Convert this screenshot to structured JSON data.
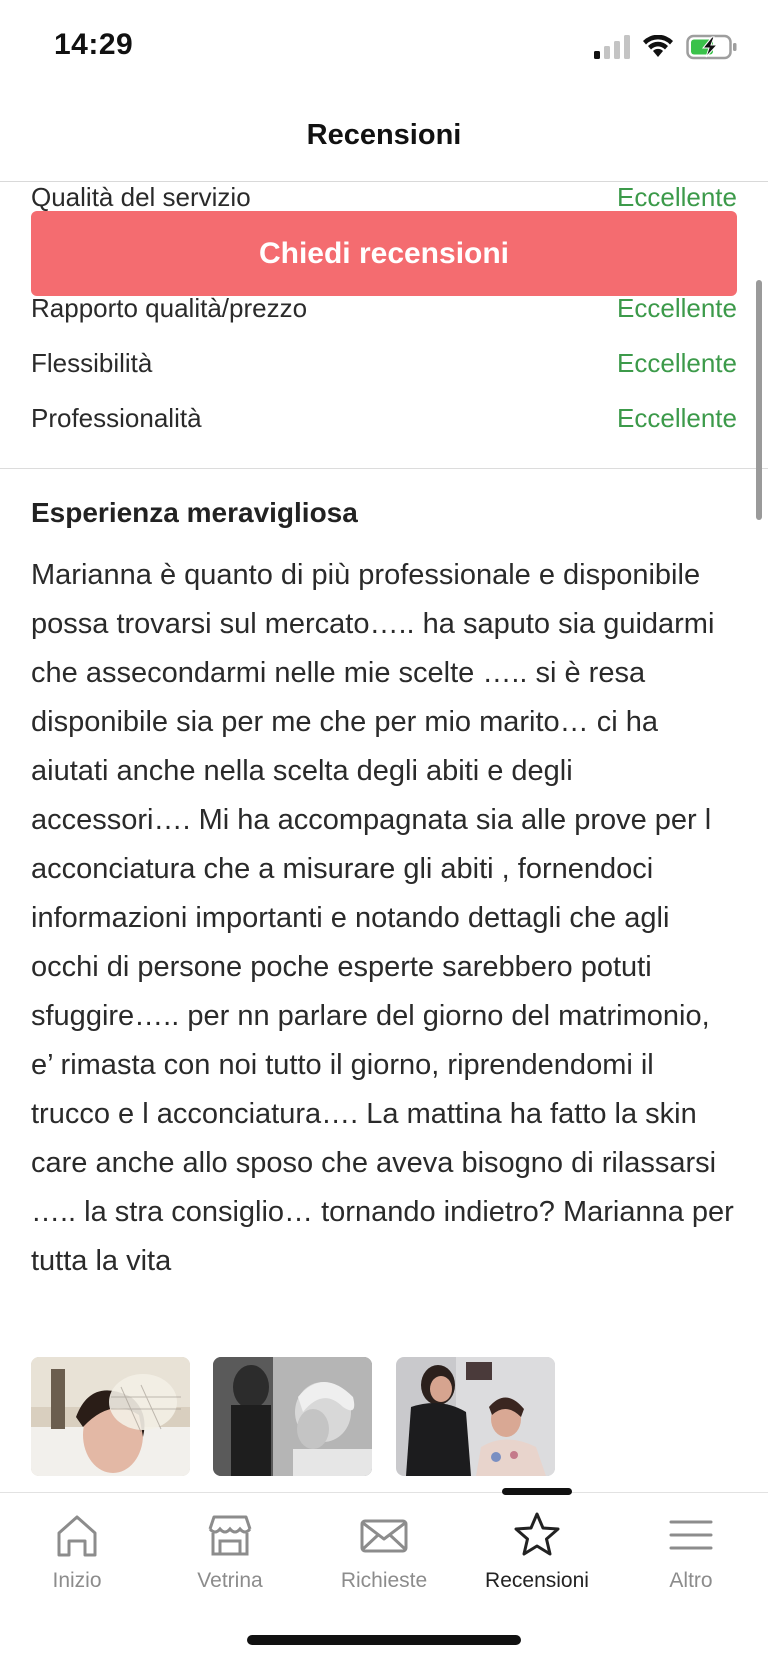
{
  "status": {
    "time": "14:29"
  },
  "header": {
    "title": "Recensioni"
  },
  "ratings": [
    {
      "label": "Qualità del servizio",
      "value": "Eccellente"
    },
    {
      "label": "Rapporto qualità/prezzo",
      "value": "Eccellente"
    },
    {
      "label": "Flessibilità",
      "value": "Eccellente"
    },
    {
      "label": "Professionalità",
      "value": "Eccellente"
    }
  ],
  "ask_button": {
    "label": "Chiedi recensioni"
  },
  "review": {
    "title": "Esperienza meravigliosa",
    "text": "Marianna è quanto di più professionale e disponibile possa trovarsi sul mercato….. ha saputo sia guidarmi che assecondarmi nelle mie scelte ….. si è resa disponibile sia per me che per mio marito… ci ha aiutati anche nella scelta degli abiti e degli accessori…. Mi ha accompagnata sia alle prove per l acconciatura che a misurare gli abiti , fornendoci informazioni importanti e notando dettagli che agli occhi di persone poche esperte sarebbero potuti sfuggire….. per nn parlare del giorno del matrimonio, e’ rimasta con noi tutto il giorno, riprendendomi il trucco e l acconciatura…. La mattina ha fatto la skin care anche allo sposo che aveva bisogno di rilassarsi ….. la stra consiglio… tornando indietro? Marianna per tutta la vita"
  },
  "tabs": [
    {
      "label": "Inizio",
      "icon": "home-icon"
    },
    {
      "label": "Vetrina",
      "icon": "storefront-icon"
    },
    {
      "label": "Richieste",
      "icon": "envelope-icon"
    },
    {
      "label": "Recensioni",
      "icon": "star-icon",
      "active": true
    },
    {
      "label": "Altro",
      "icon": "menu-icon"
    }
  ],
  "colors": {
    "accent": "#f46c70",
    "rating_green": "#3c9a4a",
    "tab_inactive": "#8c8c8c"
  }
}
